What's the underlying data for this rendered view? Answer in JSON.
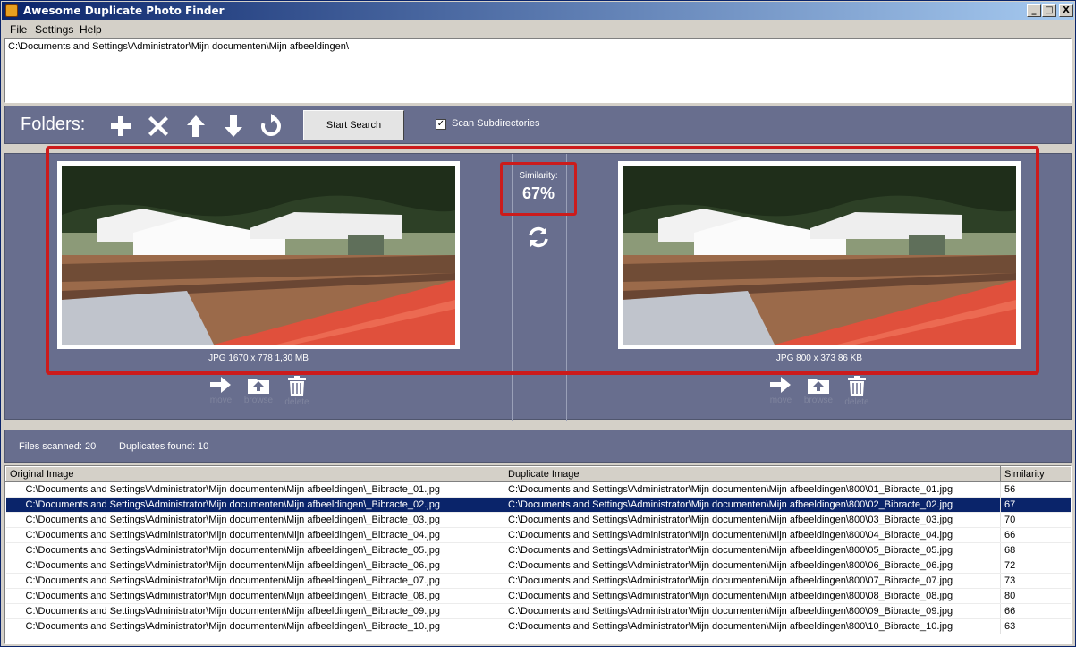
{
  "window": {
    "title": "Awesome Duplicate Photo Finder",
    "minimize": "_",
    "maximize": "□",
    "close": "X"
  },
  "menu": [
    "File",
    "Settings",
    "Help"
  ],
  "folder_list": [
    "C:\\Documents and Settings\\Administrator\\Mijn documenten\\Mijn afbeeldingen\\"
  ],
  "toolbar": {
    "folders_label": "Folders:",
    "icons": [
      "add-icon",
      "remove-icon",
      "move-up-icon",
      "move-down-icon",
      "reset-icon"
    ],
    "start_search": "Start Search",
    "scan_subdirectories": "Scan Subdirectories",
    "scan_subdirectories_checked": true
  },
  "compare": {
    "left_info": "JPG  1670 x 778  1,30 MB",
    "right_info": "JPG  800 x 373  86 KB",
    "similarity_label": "Similarity:",
    "similarity_value": "67%",
    "actions": {
      "move": "move",
      "browse": "browse",
      "delete": "delete"
    },
    "highlight_color": "#cc1b1b"
  },
  "status": {
    "files_scanned": "Files scanned: 20",
    "duplicates_found": "Duplicates found: 10"
  },
  "results": {
    "columns": [
      "Original Image",
      "Duplicate Image",
      "Similarity"
    ],
    "selected_index": 1,
    "rows": [
      {
        "original": "C:\\Documents and Settings\\Administrator\\Mijn documenten\\Mijn afbeeldingen\\_Bibracte_01.jpg",
        "duplicate": "C:\\Documents and Settings\\Administrator\\Mijn documenten\\Mijn afbeeldingen\\800\\01_Bibracte_01.jpg",
        "similarity": "56"
      },
      {
        "original": "C:\\Documents and Settings\\Administrator\\Mijn documenten\\Mijn afbeeldingen\\_Bibracte_02.jpg",
        "duplicate": "C:\\Documents and Settings\\Administrator\\Mijn documenten\\Mijn afbeeldingen\\800\\02_Bibracte_02.jpg",
        "similarity": "67"
      },
      {
        "original": "C:\\Documents and Settings\\Administrator\\Mijn documenten\\Mijn afbeeldingen\\_Bibracte_03.jpg",
        "duplicate": "C:\\Documents and Settings\\Administrator\\Mijn documenten\\Mijn afbeeldingen\\800\\03_Bibracte_03.jpg",
        "similarity": "70"
      },
      {
        "original": "C:\\Documents and Settings\\Administrator\\Mijn documenten\\Mijn afbeeldingen\\_Bibracte_04.jpg",
        "duplicate": "C:\\Documents and Settings\\Administrator\\Mijn documenten\\Mijn afbeeldingen\\800\\04_Bibracte_04.jpg",
        "similarity": "66"
      },
      {
        "original": "C:\\Documents and Settings\\Administrator\\Mijn documenten\\Mijn afbeeldingen\\_Bibracte_05.jpg",
        "duplicate": "C:\\Documents and Settings\\Administrator\\Mijn documenten\\Mijn afbeeldingen\\800\\05_Bibracte_05.jpg",
        "similarity": "68"
      },
      {
        "original": "C:\\Documents and Settings\\Administrator\\Mijn documenten\\Mijn afbeeldingen\\_Bibracte_06.jpg",
        "duplicate": "C:\\Documents and Settings\\Administrator\\Mijn documenten\\Mijn afbeeldingen\\800\\06_Bibracte_06.jpg",
        "similarity": "72"
      },
      {
        "original": "C:\\Documents and Settings\\Administrator\\Mijn documenten\\Mijn afbeeldingen\\_Bibracte_07.jpg",
        "duplicate": "C:\\Documents and Settings\\Administrator\\Mijn documenten\\Mijn afbeeldingen\\800\\07_Bibracte_07.jpg",
        "similarity": "73"
      },
      {
        "original": "C:\\Documents and Settings\\Administrator\\Mijn documenten\\Mijn afbeeldingen\\_Bibracte_08.jpg",
        "duplicate": "C:\\Documents and Settings\\Administrator\\Mijn documenten\\Mijn afbeeldingen\\800\\08_Bibracte_08.jpg",
        "similarity": "80"
      },
      {
        "original": "C:\\Documents and Settings\\Administrator\\Mijn documenten\\Mijn afbeeldingen\\_Bibracte_09.jpg",
        "duplicate": "C:\\Documents and Settings\\Administrator\\Mijn documenten\\Mijn afbeeldingen\\800\\09_Bibracte_09.jpg",
        "similarity": "66"
      },
      {
        "original": "C:\\Documents and Settings\\Administrator\\Mijn documenten\\Mijn afbeeldingen\\_Bibracte_10.jpg",
        "duplicate": "C:\\Documents and Settings\\Administrator\\Mijn documenten\\Mijn afbeeldingen\\800\\10_Bibracte_10.jpg",
        "similarity": "63"
      }
    ]
  }
}
